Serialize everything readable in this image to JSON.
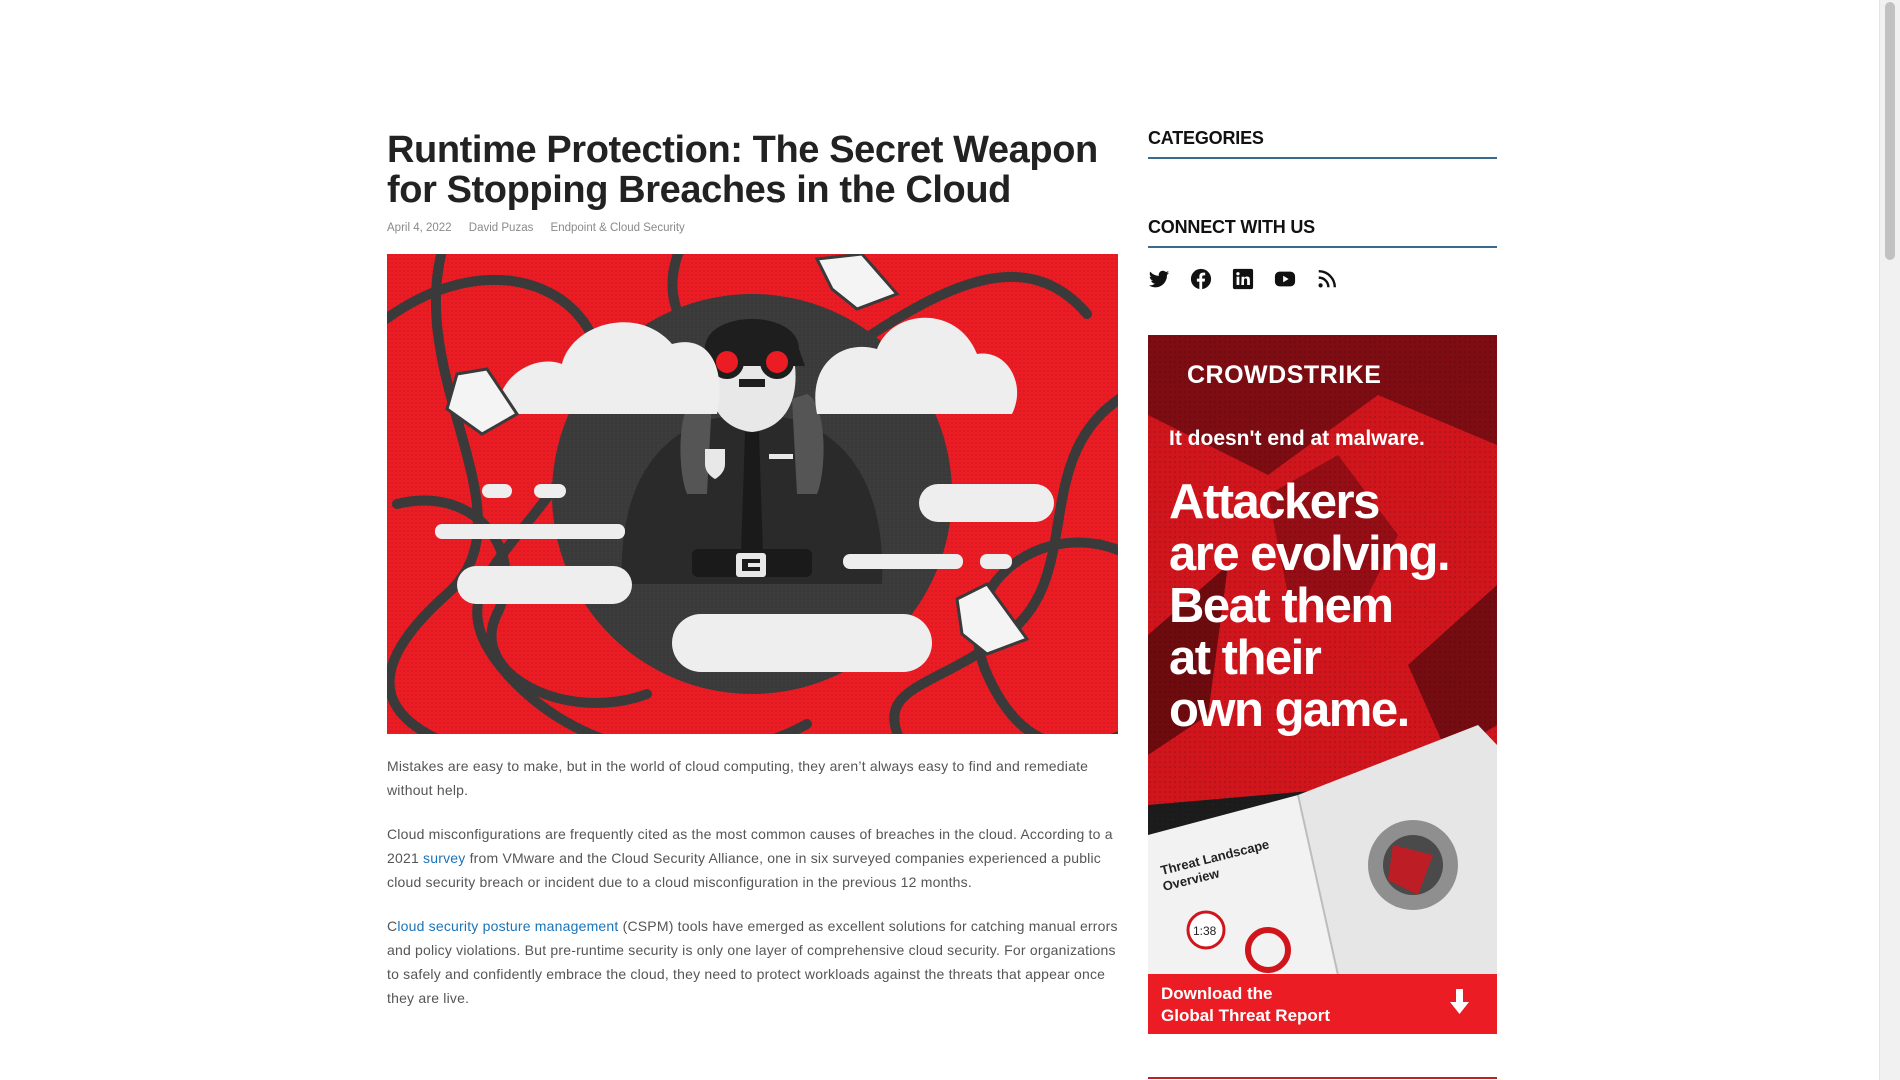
{
  "article": {
    "title": "Runtime Protection: The Secret Weapon for Stopping Breaches in the Cloud",
    "date": "April 4, 2022",
    "author": "David Puzas",
    "category": "Endpoint & Cloud Security",
    "paragraphs": [
      {
        "text": "Mistakes are easy to make, but in the world of cloud computing, they aren’t always easy to find and remediate without help."
      },
      {
        "before": "Cloud misconfigurations are frequently cited as the most common causes of breaches in the cloud. According to a 2021 ",
        "link": "survey",
        "after": " from VMware and the Cloud Security Alliance, one in six surveyed companies experienced a public cloud security breach or incident due to a cloud misconfiguration in the previous 12 months."
      },
      {
        "before": "C",
        "link": "loud security posture management",
        "after": " (CSPM) tools have emerged as excellent solutions for catching manual errors and policy violations.  But pre-runtime security is only one layer of comprehensive cloud security. For organizations to safely and confidently embrace the cloud, they need to protect workloads against the threats that appear once they are live."
      }
    ]
  },
  "sidebar": {
    "categories_title": "CATEGORIES",
    "connect_title": "CONNECT WITH US",
    "social_icons": [
      "twitter-icon",
      "facebook-icon",
      "linkedin-icon",
      "youtube-icon",
      "rss-icon"
    ]
  },
  "ad": {
    "brand": "CROWDSTRIKE",
    "tagline": "It doesn't end at malware.",
    "headline_lines": [
      "Attackers",
      "are evolving.",
      "Beat them",
      "at their",
      "own game."
    ],
    "report_title_lines": [
      "Threat Landscape",
      "Overview"
    ],
    "report_stat": "1:38",
    "cta_lines": [
      "Download the",
      "Global Threat Report"
    ]
  },
  "colors": {
    "accent_red": "#ec1c24",
    "link_blue": "#1a73b8",
    "widget_rule": "#3a6b8f"
  }
}
